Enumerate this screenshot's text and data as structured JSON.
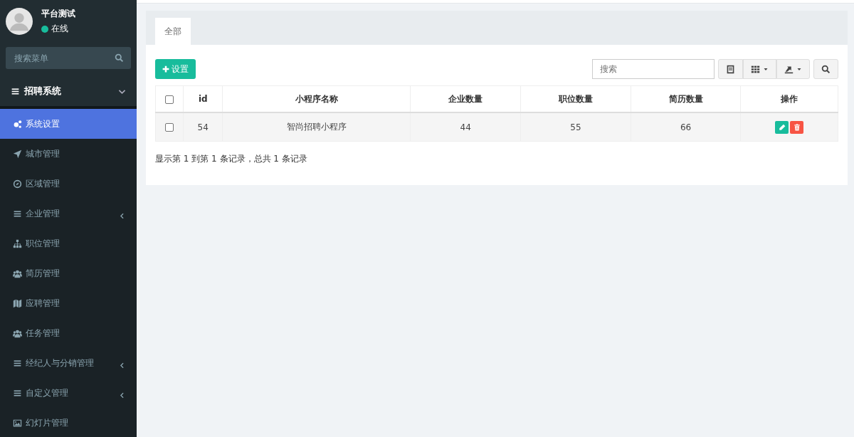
{
  "user": {
    "name": "平台测试",
    "status": "在线",
    "online": true
  },
  "sidebar": {
    "search": {
      "placeholder": "搜索菜单"
    },
    "group": {
      "label": "招聘系统",
      "expanded": true
    },
    "items": [
      {
        "label": "系统设置",
        "selected": true,
        "submenu": false
      },
      {
        "label": "城市管理",
        "selected": false,
        "submenu": false
      },
      {
        "label": "区域管理",
        "selected": false,
        "submenu": false
      },
      {
        "label": "企业管理",
        "selected": false,
        "submenu": true
      },
      {
        "label": "职位管理",
        "selected": false,
        "submenu": false
      },
      {
        "label": "简历管理",
        "selected": false,
        "submenu": false
      },
      {
        "label": "应聘管理",
        "selected": false,
        "submenu": false
      },
      {
        "label": "任务管理",
        "selected": false,
        "submenu": false
      },
      {
        "label": "经纪人与分销管理",
        "selected": false,
        "submenu": true
      },
      {
        "label": "自定义管理",
        "selected": false,
        "submenu": true
      },
      {
        "label": "幻灯片管理",
        "selected": false,
        "submenu": false
      }
    ]
  },
  "tabs": [
    {
      "label": "全部",
      "selected": true
    }
  ],
  "toolbar": {
    "add_button": "设置",
    "search": {
      "placeholder": "搜索"
    }
  },
  "table": {
    "all_checked": false,
    "columns": [
      "id",
      "小程序名称",
      "企业数量",
      "职位数量",
      "简历数量",
      "操作"
    ],
    "rows": [
      {
        "checked": false,
        "cells": [
          "54",
          "智尚招聘小程序",
          "44",
          "55",
          "66"
        ]
      }
    ]
  },
  "pagination": "显示第 1 到第 1 条记录，总共 1 条记录"
}
